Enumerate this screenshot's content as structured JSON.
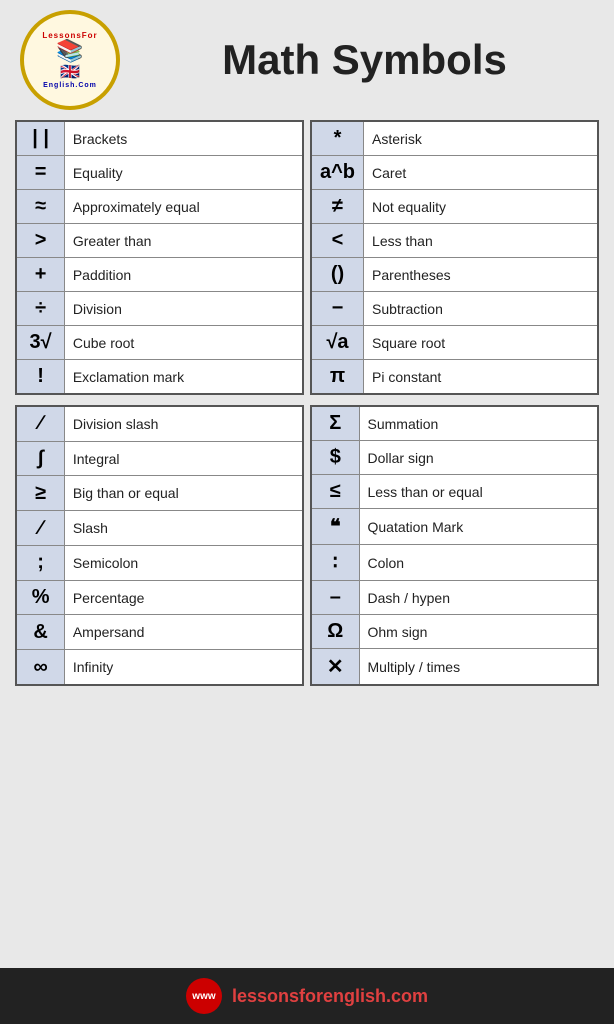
{
  "header": {
    "title": "Math Symbols",
    "logo_top": "LessonsFor",
    "logo_bottom": "English.Com"
  },
  "table1_left": [
    {
      "symbol": "| |",
      "name": "Brackets"
    },
    {
      "symbol": "=",
      "name": "Equality"
    },
    {
      "symbol": "≈",
      "name": "Approximately equal"
    },
    {
      "symbol": ">",
      "name": "Greater than"
    },
    {
      "symbol": "+",
      "name": "Paddition"
    },
    {
      "symbol": "÷",
      "name": "Division"
    },
    {
      "symbol": "3√",
      "name": "Cube root"
    },
    {
      "symbol": "!",
      "name": "Exclamation mark"
    }
  ],
  "table1_right": [
    {
      "symbol": "*",
      "name": "Asterisk"
    },
    {
      "symbol": "a^b",
      "name": "Caret"
    },
    {
      "symbol": "≠",
      "name": "Not equality"
    },
    {
      "symbol": "<",
      "name": "Less than"
    },
    {
      "symbol": "()",
      "name": "Parentheses"
    },
    {
      "symbol": "−",
      "name": "Subtraction"
    },
    {
      "symbol": "√a",
      "name": "Square root"
    },
    {
      "symbol": "π",
      "name": "Pi constant"
    }
  ],
  "table2_left": [
    {
      "symbol": "∕",
      "name": "Division slash"
    },
    {
      "symbol": "∫",
      "name": "Integral"
    },
    {
      "symbol": "≥",
      "name": "Big than or equal"
    },
    {
      "symbol": "∕",
      "name": "Slash"
    },
    {
      "symbol": ";",
      "name": "Semicolon"
    },
    {
      "symbol": "%",
      "name": "Percentage"
    },
    {
      "symbol": "&",
      "name": "Ampersand"
    },
    {
      "symbol": "∞",
      "name": "Infinity"
    }
  ],
  "table2_right": [
    {
      "symbol": "Σ",
      "name": "Summation"
    },
    {
      "symbol": "$",
      "name": "Dollar sign"
    },
    {
      "symbol": "≤",
      "name": "Less than or equal"
    },
    {
      "symbol": "❝",
      "name": "Quatation Mark"
    },
    {
      "symbol": "∶",
      "name": "Colon"
    },
    {
      "symbol": "–",
      "name": "Dash / hypen"
    },
    {
      "symbol": "Ω",
      "name": "Ohm sign"
    },
    {
      "symbol": "✕",
      "name": "Multiply / times"
    }
  ],
  "footer": {
    "text": "lessonsforenglish.com",
    "text_colored": "lessons",
    "text_plain": "forenglish.com"
  }
}
